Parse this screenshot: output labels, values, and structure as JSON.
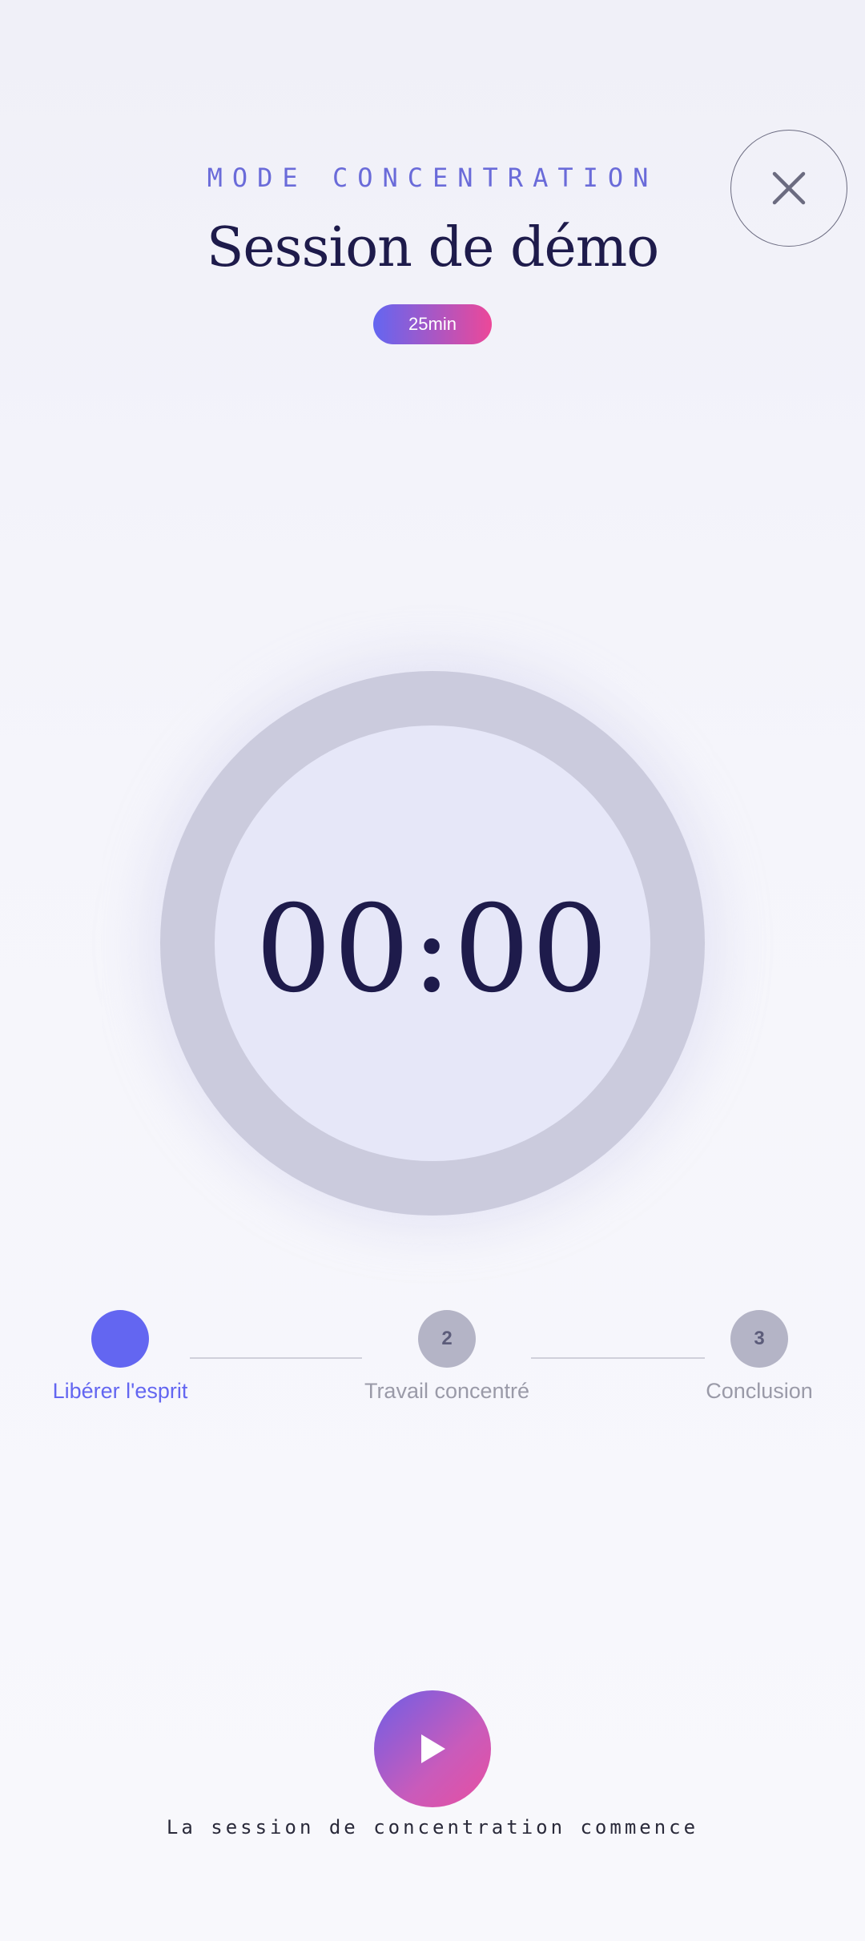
{
  "header": {
    "eyebrow": "MODE CONCENTRATION",
    "title": "Session de démo",
    "duration_badge": "25min",
    "close_icon": "close-icon"
  },
  "timer": {
    "display": "00:00"
  },
  "steps": [
    {
      "number": "",
      "label": "Libérer l'esprit",
      "state": "active",
      "color": "#6366f1"
    },
    {
      "number": "2",
      "label": "Travail concentré",
      "state": "pending",
      "color": "#b4b4c6"
    },
    {
      "number": "3",
      "label": "Conclusion",
      "state": "pending",
      "color": "#b4b4c6"
    }
  ],
  "controls": {
    "play_icon": "play-icon",
    "status": "La session de concentration commence"
  },
  "colors": {
    "accent": "#6366f1",
    "accent_pink": "#ec4899",
    "title": "#1e1b4b",
    "ring": "#cbcbdd",
    "ring_inner": "#e6e7f8"
  }
}
